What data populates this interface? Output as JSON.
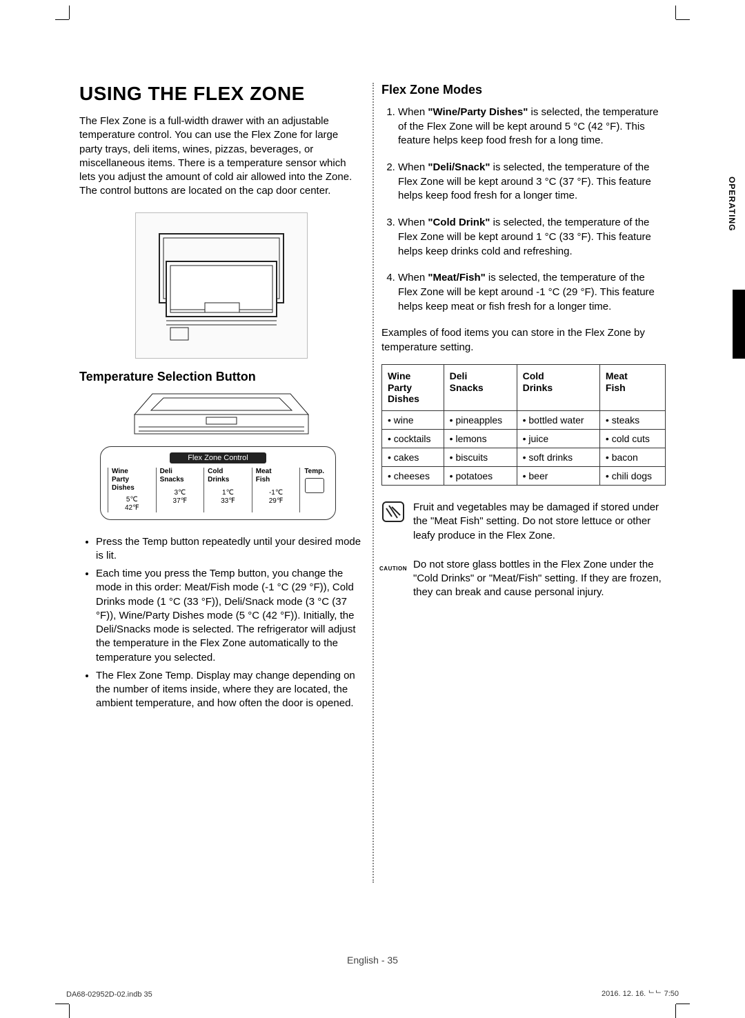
{
  "left": {
    "title": "USING THE FLEX ZONE",
    "intro": "The Flex Zone is a full-width drawer with an adjustable temperature control. You can use the Flex Zone for large party trays, deli items, wines, pizzas, beverages, or miscellaneous items. There is a temperature sensor which lets you adjust the amount of cold air allowed into the Zone. The control buttons are located on the cap door center.",
    "subheading": "Temperature Selection Button",
    "panel": {
      "title": "Flex Zone Control",
      "temp_label": "Temp.",
      "cols": [
        {
          "label": "Wine\nParty\nDishes",
          "c": "5℃",
          "f": "42℉"
        },
        {
          "label": "Deli\nSnacks",
          "c": "3℃",
          "f": "37℉"
        },
        {
          "label": "Cold\nDrinks",
          "c": "1℃",
          "f": "33℉"
        },
        {
          "label": "Meat\nFish",
          "c": "-1℃",
          "f": "29℉"
        }
      ]
    },
    "bullets": [
      "Press the Temp button repeatedly until your desired mode is lit.",
      "Each time you press the Temp button, you change the mode in this order: Meat/Fish mode (-1 °C (29 °F)), Cold Drinks mode (1 °C (33 °F)), Deli/Snack mode (3 °C (37 °F)), Wine/Party Dishes mode (5 °C (42 °F)). Initially, the Deli/Snacks mode is selected. The refrigerator will adjust the temperature in the Flex Zone automatically to the temperature you selected.",
      "The Flex Zone Temp. Display may change depending on the number of items inside, where they are located, the ambient temperature, and how often the door is opened."
    ]
  },
  "right": {
    "section_title": "Flex Zone Modes",
    "modes": [
      {
        "prefix": "When ",
        "bold": "\"Wine/Party Dishes\"",
        "text": " is selected, the temperature of the Flex Zone will be kept around 5 °C (42 °F). This feature helps keep food fresh for a long time."
      },
      {
        "prefix": "When ",
        "bold": "\"Deli/Snack\"",
        "text": " is selected, the temperature of the Flex Zone will be kept around 3 °C (37 °F). This feature helps keep food fresh for a longer time."
      },
      {
        "prefix": "When ",
        "bold": "\"Cold Drink\"",
        "text": " is selected, the temperature of the Flex Zone will be kept around 1 °C (33 °F). This feature helps keep drinks cold and refreshing."
      },
      {
        "prefix": "When ",
        "bold": "\"Meat/Fish\"",
        "text": " is selected, the temperature of the Flex Zone will be kept around -1 °C (29 °F). This feature helps keep meat or fish fresh for a longer time."
      }
    ],
    "examples_intro": "Examples of food items you can store in the Flex Zone by temperature setting.",
    "table": {
      "headers": [
        "Wine\nParty\nDishes",
        "Deli\nSnacks",
        "Cold\nDrinks",
        "Meat\nFish"
      ],
      "rows": [
        [
          "wine",
          "pineapples",
          "bottled water",
          "steaks"
        ],
        [
          "cocktails",
          "lemons",
          "juice",
          "cold cuts"
        ],
        [
          "cakes",
          "biscuits",
          "soft drinks",
          "bacon"
        ],
        [
          "cheeses",
          "potatoes",
          "beer",
          "chili dogs"
        ]
      ]
    },
    "note1": "Fruit and vegetables may be damaged if stored under the \"Meat Fish\" setting. Do not store lettuce or other leafy produce in the Flex Zone.",
    "caution_label": "CAUTION",
    "note2": "Do not store glass bottles in the Flex Zone under the \"Cold Drinks\" or \"Meat/Fish\" setting. If they are frozen, they can break and cause personal injury."
  },
  "side_tab": "OPERATING",
  "footer": {
    "center": "English - 35",
    "left": "DA68-02952D-02.indb   35",
    "right": "2016. 12. 16.   ᄂᄂ 7:50"
  }
}
